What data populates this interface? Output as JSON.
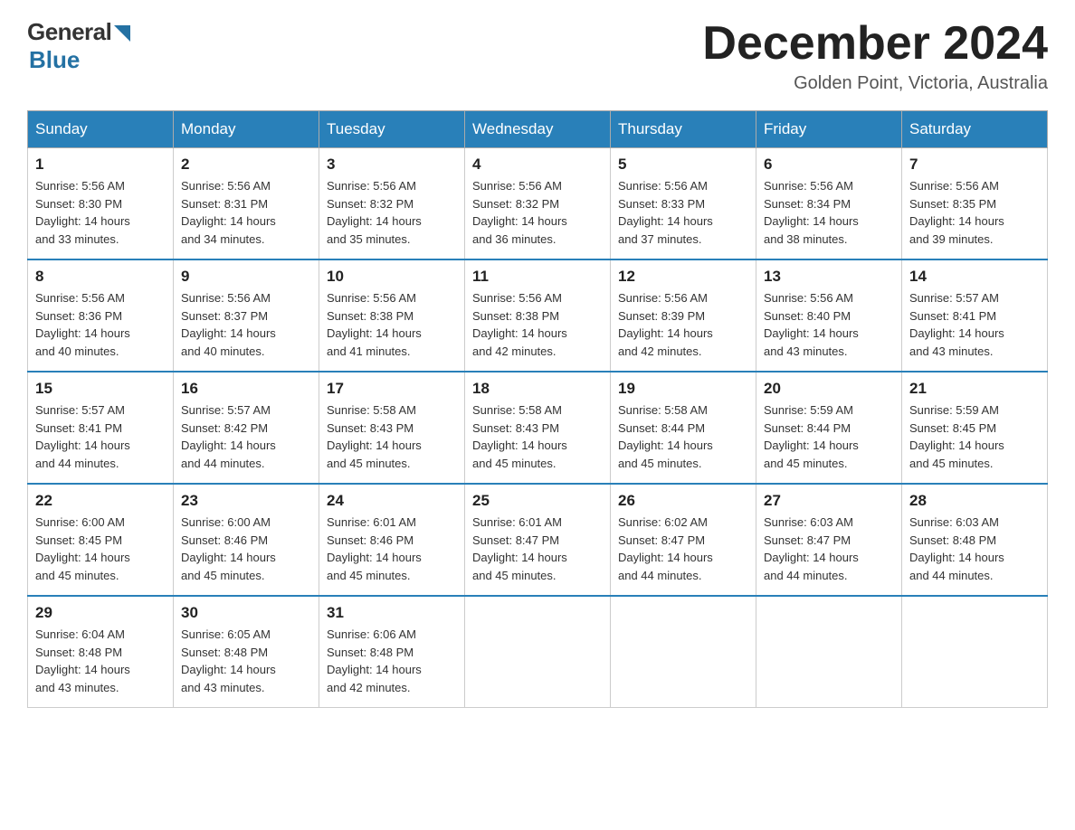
{
  "header": {
    "logo_general": "General",
    "logo_blue": "Blue",
    "month_title": "December 2024",
    "location": "Golden Point, Victoria, Australia"
  },
  "days_of_week": [
    "Sunday",
    "Monday",
    "Tuesday",
    "Wednesday",
    "Thursday",
    "Friday",
    "Saturday"
  ],
  "weeks": [
    [
      {
        "day": "1",
        "sunrise": "5:56 AM",
        "sunset": "8:30 PM",
        "daylight": "14 hours and 33 minutes."
      },
      {
        "day": "2",
        "sunrise": "5:56 AM",
        "sunset": "8:31 PM",
        "daylight": "14 hours and 34 minutes."
      },
      {
        "day": "3",
        "sunrise": "5:56 AM",
        "sunset": "8:32 PM",
        "daylight": "14 hours and 35 minutes."
      },
      {
        "day": "4",
        "sunrise": "5:56 AM",
        "sunset": "8:32 PM",
        "daylight": "14 hours and 36 minutes."
      },
      {
        "day": "5",
        "sunrise": "5:56 AM",
        "sunset": "8:33 PM",
        "daylight": "14 hours and 37 minutes."
      },
      {
        "day": "6",
        "sunrise": "5:56 AM",
        "sunset": "8:34 PM",
        "daylight": "14 hours and 38 minutes."
      },
      {
        "day": "7",
        "sunrise": "5:56 AM",
        "sunset": "8:35 PM",
        "daylight": "14 hours and 39 minutes."
      }
    ],
    [
      {
        "day": "8",
        "sunrise": "5:56 AM",
        "sunset": "8:36 PM",
        "daylight": "14 hours and 40 minutes."
      },
      {
        "day": "9",
        "sunrise": "5:56 AM",
        "sunset": "8:37 PM",
        "daylight": "14 hours and 40 minutes."
      },
      {
        "day": "10",
        "sunrise": "5:56 AM",
        "sunset": "8:38 PM",
        "daylight": "14 hours and 41 minutes."
      },
      {
        "day": "11",
        "sunrise": "5:56 AM",
        "sunset": "8:38 PM",
        "daylight": "14 hours and 42 minutes."
      },
      {
        "day": "12",
        "sunrise": "5:56 AM",
        "sunset": "8:39 PM",
        "daylight": "14 hours and 42 minutes."
      },
      {
        "day": "13",
        "sunrise": "5:56 AM",
        "sunset": "8:40 PM",
        "daylight": "14 hours and 43 minutes."
      },
      {
        "day": "14",
        "sunrise": "5:57 AM",
        "sunset": "8:41 PM",
        "daylight": "14 hours and 43 minutes."
      }
    ],
    [
      {
        "day": "15",
        "sunrise": "5:57 AM",
        "sunset": "8:41 PM",
        "daylight": "14 hours and 44 minutes."
      },
      {
        "day": "16",
        "sunrise": "5:57 AM",
        "sunset": "8:42 PM",
        "daylight": "14 hours and 44 minutes."
      },
      {
        "day": "17",
        "sunrise": "5:58 AM",
        "sunset": "8:43 PM",
        "daylight": "14 hours and 45 minutes."
      },
      {
        "day": "18",
        "sunrise": "5:58 AM",
        "sunset": "8:43 PM",
        "daylight": "14 hours and 45 minutes."
      },
      {
        "day": "19",
        "sunrise": "5:58 AM",
        "sunset": "8:44 PM",
        "daylight": "14 hours and 45 minutes."
      },
      {
        "day": "20",
        "sunrise": "5:59 AM",
        "sunset": "8:44 PM",
        "daylight": "14 hours and 45 minutes."
      },
      {
        "day": "21",
        "sunrise": "5:59 AM",
        "sunset": "8:45 PM",
        "daylight": "14 hours and 45 minutes."
      }
    ],
    [
      {
        "day": "22",
        "sunrise": "6:00 AM",
        "sunset": "8:45 PM",
        "daylight": "14 hours and 45 minutes."
      },
      {
        "day": "23",
        "sunrise": "6:00 AM",
        "sunset": "8:46 PM",
        "daylight": "14 hours and 45 minutes."
      },
      {
        "day": "24",
        "sunrise": "6:01 AM",
        "sunset": "8:46 PM",
        "daylight": "14 hours and 45 minutes."
      },
      {
        "day": "25",
        "sunrise": "6:01 AM",
        "sunset": "8:47 PM",
        "daylight": "14 hours and 45 minutes."
      },
      {
        "day": "26",
        "sunrise": "6:02 AM",
        "sunset": "8:47 PM",
        "daylight": "14 hours and 44 minutes."
      },
      {
        "day": "27",
        "sunrise": "6:03 AM",
        "sunset": "8:47 PM",
        "daylight": "14 hours and 44 minutes."
      },
      {
        "day": "28",
        "sunrise": "6:03 AM",
        "sunset": "8:48 PM",
        "daylight": "14 hours and 44 minutes."
      }
    ],
    [
      {
        "day": "29",
        "sunrise": "6:04 AM",
        "sunset": "8:48 PM",
        "daylight": "14 hours and 43 minutes."
      },
      {
        "day": "30",
        "sunrise": "6:05 AM",
        "sunset": "8:48 PM",
        "daylight": "14 hours and 43 minutes."
      },
      {
        "day": "31",
        "sunrise": "6:06 AM",
        "sunset": "8:48 PM",
        "daylight": "14 hours and 42 minutes."
      },
      null,
      null,
      null,
      null
    ]
  ],
  "labels": {
    "sunrise": "Sunrise:",
    "sunset": "Sunset:",
    "daylight": "Daylight:"
  }
}
